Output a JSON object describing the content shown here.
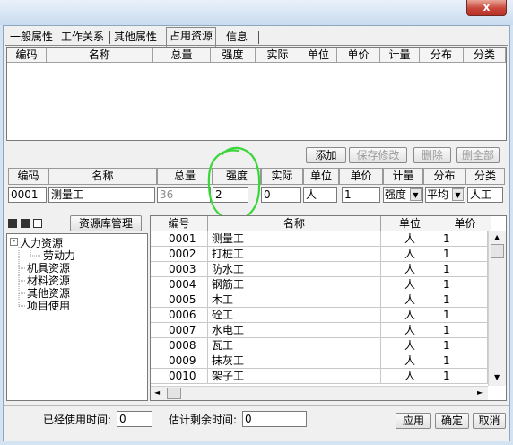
{
  "window": {
    "close_glyph": "x"
  },
  "tabs": [
    "一般属性",
    "工作关系",
    "其他属性",
    "占用资源",
    "信息"
  ],
  "top_grid": {
    "columns": [
      "编码",
      "名称",
      "总量",
      "强度",
      "实际",
      "单位",
      "单价",
      "计量",
      "分布",
      "分类"
    ]
  },
  "actions": {
    "add": "添加",
    "save": "保存修改",
    "delete": "删除",
    "delete_all": "删全部"
  },
  "form": {
    "headers": [
      "编码",
      "名称",
      "总量",
      "强度",
      "实际",
      "单位",
      "单价",
      "计量",
      "分布",
      "分类"
    ],
    "code": "0001",
    "name": "测量工",
    "total": "36",
    "intensity": "2",
    "actual": "0",
    "unit": "人",
    "price": "1",
    "measure": "强度",
    "distribution": "平均",
    "category": "人工"
  },
  "library_button": "资源库管理",
  "tree": {
    "root": "人力资源",
    "child": "劳动力",
    "items": [
      "机具资源",
      "材料资源",
      "其他资源",
      "项目使用"
    ]
  },
  "resource_grid": {
    "columns": [
      "编号",
      "名称",
      "单位",
      "单价"
    ],
    "rows": [
      [
        "0001",
        "测量工",
        "人",
        "1"
      ],
      [
        "0002",
        "打桩工",
        "人",
        "1"
      ],
      [
        "0003",
        "防水工",
        "人",
        "1"
      ],
      [
        "0004",
        "钢筋工",
        "人",
        "1"
      ],
      [
        "0005",
        "木工",
        "人",
        "1"
      ],
      [
        "0006",
        "砼工",
        "人",
        "1"
      ],
      [
        "0007",
        "水电工",
        "人",
        "1"
      ],
      [
        "0008",
        "瓦工",
        "人",
        "1"
      ],
      [
        "0009",
        "抹灰工",
        "人",
        "1"
      ],
      [
        "0010",
        "架子工",
        "人",
        "1"
      ]
    ]
  },
  "status": {
    "used_label": "已经使用时间:",
    "used_value": "0",
    "remaining_label": "估计剩余时间:",
    "remaining_value": "0"
  },
  "dialog_buttons": {
    "apply": "应用",
    "ok": "确定",
    "cancel": "取消"
  },
  "annotation_color": "#3ad63a"
}
